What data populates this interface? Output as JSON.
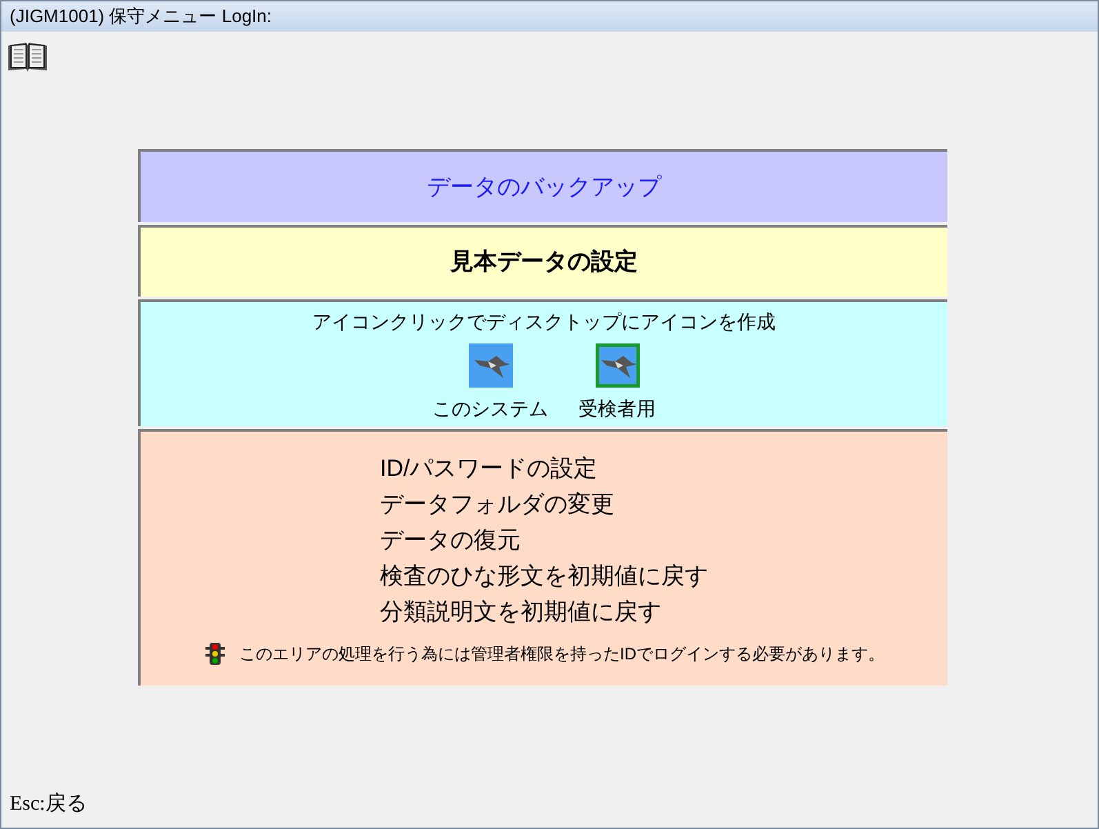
{
  "window": {
    "title": "(JIGM1001) 保守メニュー LogIn:"
  },
  "backup": {
    "label": "データのバックアップ"
  },
  "sample": {
    "label": "見本データの設定"
  },
  "shortcuts": {
    "caption": "アイコンクリックでディスクトップにアイコンを作成",
    "items": [
      {
        "label": "このシステム",
        "kind": "plain"
      },
      {
        "label": "受検者用",
        "kind": "framed"
      }
    ]
  },
  "admin": {
    "items": [
      "ID/パスワードの設定",
      "データフォルダの変更",
      "データの復元",
      "検査のひな形文を初期値に戻す",
      "分類説明文を初期値に戻す"
    ],
    "notice": "このエリアの処理を行う為には管理者権限を持ったIDでログインする必要があります。"
  },
  "footer": {
    "hint": "Esc:戻る"
  }
}
